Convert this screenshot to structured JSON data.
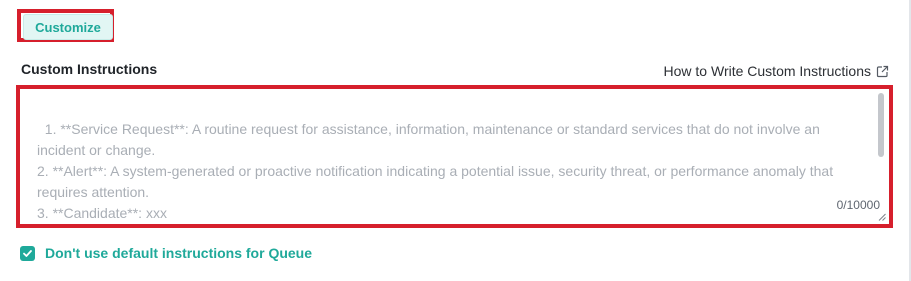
{
  "customize": {
    "label": "Customize"
  },
  "custom_instructions": {
    "label": "Custom Instructions",
    "help_link": "How to Write Custom Instructions",
    "placeholder": "1. **Service Request**: A routine request for assistance, information, maintenance or standard services that do not involve an incident or change.\n2. **Alert**: A system-generated or proactive notification indicating a potential issue, security threat, or performance anomaly that requires attention.\n3. **Candidate**: xxx",
    "value": "",
    "char_count": "0/10000"
  },
  "queue_option": {
    "label": "Don't use default instructions for Queue",
    "checked": true
  },
  "colors": {
    "accent": "#1fa99a",
    "highlight": "#d61f2c",
    "placeholder_text": "#a9aeb5"
  },
  "icons": {
    "help_link_icon": "external-link-icon",
    "checkbox_icon": "check-icon"
  }
}
